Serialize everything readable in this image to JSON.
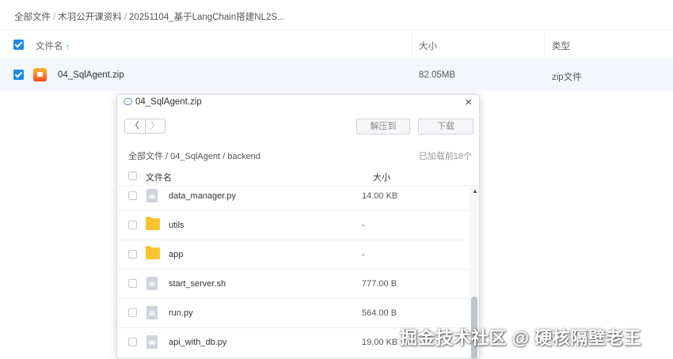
{
  "breadcrumb": [
    "全部文件",
    "木羽公开课资料",
    "20251104_基于LangChain搭建NL2S..."
  ],
  "columns": {
    "name": "文件名",
    "size": "大小",
    "type": "类型"
  },
  "file": {
    "name": "04_SqlAgent.zip",
    "size": "82.05MB",
    "type": "zip文件"
  },
  "modal": {
    "title": "04_SqlAgent.zip",
    "close": "×",
    "back": "〈",
    "forward": "〉",
    "extract_label": "解压到",
    "download_label": "下载",
    "path": "全部文件 / 04_SqlAgent / backend",
    "loaded_count": "已加载前18个",
    "col_name": "文件名",
    "col_size": "大小",
    "scroll_up": "▲",
    "rows": [
      {
        "name": "data_manager.py",
        "size": "14.00 KB",
        "kind": "file"
      },
      {
        "name": "utils",
        "size": "-",
        "kind": "folder"
      },
      {
        "name": "app",
        "size": "-",
        "kind": "folder"
      },
      {
        "name": "start_server.sh",
        "size": "777.00 B",
        "kind": "file"
      },
      {
        "name": "run.py",
        "size": "564.00 B",
        "kind": "file"
      },
      {
        "name": "api_with_db.py",
        "size": "19.00 KB",
        "kind": "file"
      }
    ]
  },
  "watermark": "掘金技术社区 @ 硬核隔壁老王",
  "colors": {
    "accent": "#1a88e8",
    "folder": "#fbc531",
    "selected_row": "#f3f6fb"
  }
}
